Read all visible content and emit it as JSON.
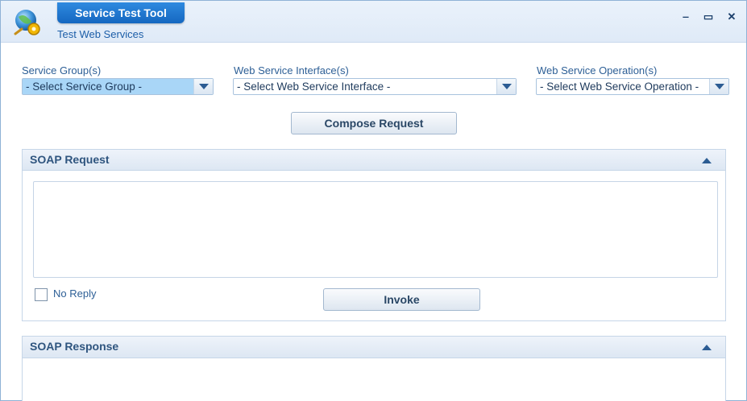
{
  "app": {
    "title": "Service Test Tool",
    "subtitle": "Test Web Services",
    "controls": {
      "minimize": "‒",
      "maximize": "▭",
      "close": "✕"
    }
  },
  "filters": {
    "service_group": {
      "label": "Service Group(s)",
      "value": "- Select Service Group -"
    },
    "interface": {
      "label": "Web Service Interface(s)",
      "value": "- Select Web Service Interface -"
    },
    "operation": {
      "label": "Web Service Operation(s)",
      "value": "- Select Web Service Operation -"
    }
  },
  "compose_button": "Compose Request",
  "soap_request": {
    "title": "SOAP Request",
    "body": "",
    "no_reply_label": "No Reply",
    "no_reply_checked": false,
    "invoke_button": "Invoke"
  },
  "soap_response": {
    "title": "SOAP Response"
  },
  "colors": {
    "accent": "#1467c0",
    "selected_combo": "#a9d6f7",
    "label": "#2d5f96"
  }
}
